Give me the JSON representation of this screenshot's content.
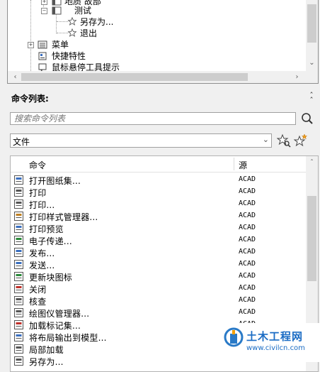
{
  "tree": {
    "items": [
      {
        "label": "地质 故部",
        "level": 2,
        "icon": "folder-icon"
      },
      {
        "label": "测试",
        "level": 2,
        "icon": "folder-icon"
      },
      {
        "label": "另存为...",
        "level": 3,
        "icon": "star-icon"
      },
      {
        "label": "退出",
        "level": 3,
        "icon": "star-icon"
      },
      {
        "label": "菜单",
        "level": 1,
        "icon": "menu-icon"
      },
      {
        "label": "快捷特性",
        "level": 1,
        "icon": "quick-properties-icon"
      },
      {
        "label": "鼠标悬停工具提示",
        "level": 1,
        "icon": "tooltip-icon"
      }
    ]
  },
  "command_list": {
    "title": "命令列表:",
    "search_placeholder": "搜索命令列表",
    "category": "文件",
    "columns": {
      "command": "命令",
      "source": "源"
    },
    "rows": [
      {
        "name": "打开图纸集...",
        "source": "ACAD",
        "icon": "open-sheetset-icon"
      },
      {
        "name": "打印",
        "source": "ACAD",
        "icon": "print-icon"
      },
      {
        "name": "打印...",
        "source": "ACAD",
        "icon": "print-dialog-icon"
      },
      {
        "name": "打印样式管理器...",
        "source": "ACAD",
        "icon": "plot-style-manager-icon"
      },
      {
        "name": "打印预览",
        "source": "ACAD",
        "icon": "print-preview-icon"
      },
      {
        "name": "电子传递...",
        "source": "ACAD",
        "icon": "etransmit-icon"
      },
      {
        "name": "发布...",
        "source": "ACAD",
        "icon": "publish-icon"
      },
      {
        "name": "发送...",
        "source": "ACAD",
        "icon": "send-icon"
      },
      {
        "name": "更新块图标",
        "source": "ACAD",
        "icon": "update-block-icon"
      },
      {
        "name": "关闭",
        "source": "ACAD",
        "icon": "close-file-icon"
      },
      {
        "name": "核查",
        "source": "ACAD",
        "icon": "audit-icon"
      },
      {
        "name": "绘图仪管理器...",
        "source": "ACAD",
        "icon": "plotter-manager-icon"
      },
      {
        "name": "加载标记集...",
        "source": "ACAD",
        "icon": "markup-icon"
      },
      {
        "name": "将布局输出到模型...",
        "source": "ACAD",
        "icon": "export-layout-icon"
      },
      {
        "name": "局部加载",
        "source": "",
        "icon": "partial-load-icon"
      },
      {
        "name": "另存为...",
        "source": "",
        "icon": "save-as-icon"
      }
    ]
  },
  "watermark": {
    "brand": "土木工程网",
    "url": "www.civilcn.com"
  }
}
